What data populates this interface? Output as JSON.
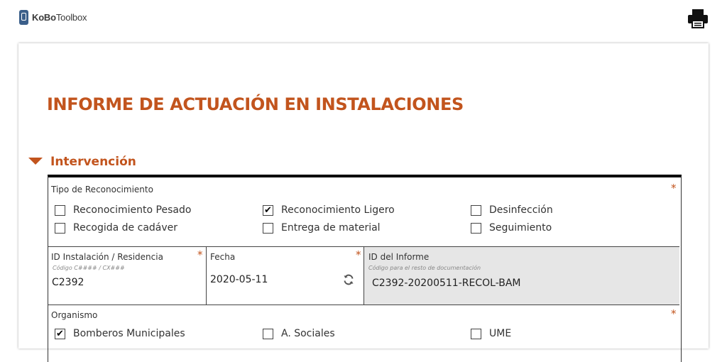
{
  "app": {
    "logo_bold": "KoBo",
    "logo_light": "Toolbox"
  },
  "toolbar": {
    "print_icon": "printer-icon"
  },
  "form": {
    "title": "INFORME DE ACTUACIÓN EN INSTALACIONES"
  },
  "group": {
    "title": "Intervención",
    "tipo": {
      "label": "Tipo de Reconocimiento",
      "required": "*",
      "options": [
        {
          "label": "Reconocimiento Pesado",
          "checked": false
        },
        {
          "label": "Reconocimiento Ligero",
          "checked": true
        },
        {
          "label": "Desinfección",
          "checked": false
        },
        {
          "label": "Recogida de cadáver",
          "checked": false
        },
        {
          "label": "Entrega de material",
          "checked": false
        },
        {
          "label": "Seguimiento",
          "checked": false
        }
      ]
    },
    "id_instalacion": {
      "label": "ID Instalación / Residencia",
      "hint": "Código C#### / CX###",
      "value": "C2392",
      "required": "*"
    },
    "fecha": {
      "label": "Fecha",
      "value": "2020-05-11",
      "required": "*",
      "icon": "refresh-icon"
    },
    "id_informe": {
      "label": "ID del Informe",
      "hint": "Código para el resto de documentación",
      "value": "C2392-20200511-RECOL-BAM"
    },
    "organismo": {
      "label": "Organismo",
      "required": "*",
      "options": [
        {
          "label": "Bomberos Municipales",
          "checked": true
        },
        {
          "label": "A. Sociales",
          "checked": false
        },
        {
          "label": "UME",
          "checked": false
        }
      ]
    }
  },
  "colors": {
    "accent": "#c2541d",
    "readonly_bg": "#e6e6e6"
  }
}
